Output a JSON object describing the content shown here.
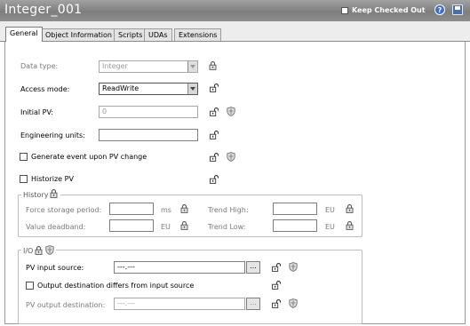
{
  "window": {
    "title": "Integer_001",
    "keep_checked_out": "Keep Checked Out",
    "keep_checked_out_checked": false,
    "help_icon": "help-icon",
    "save_icon": "save-icon"
  },
  "tabs": [
    {
      "label": "General",
      "active": true
    },
    {
      "label": "Object Information",
      "active": false
    },
    {
      "label": "Scripts",
      "active": false
    },
    {
      "label": "UDAs",
      "active": false
    },
    {
      "label": "Extensions",
      "active": false
    }
  ],
  "general": {
    "data_type": {
      "label": "Data type:",
      "value": "Integer"
    },
    "access_mode": {
      "label": "Access mode:",
      "value": "ReadWrite"
    },
    "initial_pv": {
      "label": "Initial PV:",
      "value": "0"
    },
    "engineering_units": {
      "label": "Engineering units:",
      "value": ""
    },
    "generate_event": {
      "label": "Generate event upon PV change",
      "checked": false
    },
    "historize_pv": {
      "label": "Historize PV",
      "checked": false
    }
  },
  "history": {
    "title": "History",
    "force_storage_period": {
      "label": "Force storage period:",
      "value": "",
      "unit": "ms"
    },
    "value_deadband": {
      "label": "Value deadband:",
      "value": "",
      "unit": "EU"
    },
    "trend_high": {
      "label": "Trend High:",
      "value": "",
      "unit": "EU"
    },
    "trend_low": {
      "label": "Trend Low:",
      "value": "",
      "unit": "EU"
    }
  },
  "io": {
    "title": "I/O",
    "pv_input_source": {
      "label": "PV input source:",
      "value": "---.---",
      "button": "..."
    },
    "output_differs": {
      "label": "Output destination differs from input source",
      "checked": false
    },
    "pv_output_destination": {
      "label": "PV output destination:",
      "value": "---.---",
      "button": "..."
    }
  },
  "colors": {
    "titlebar": "#8e8e8e",
    "lock": "#333333",
    "shield": "#6f6f6f"
  }
}
